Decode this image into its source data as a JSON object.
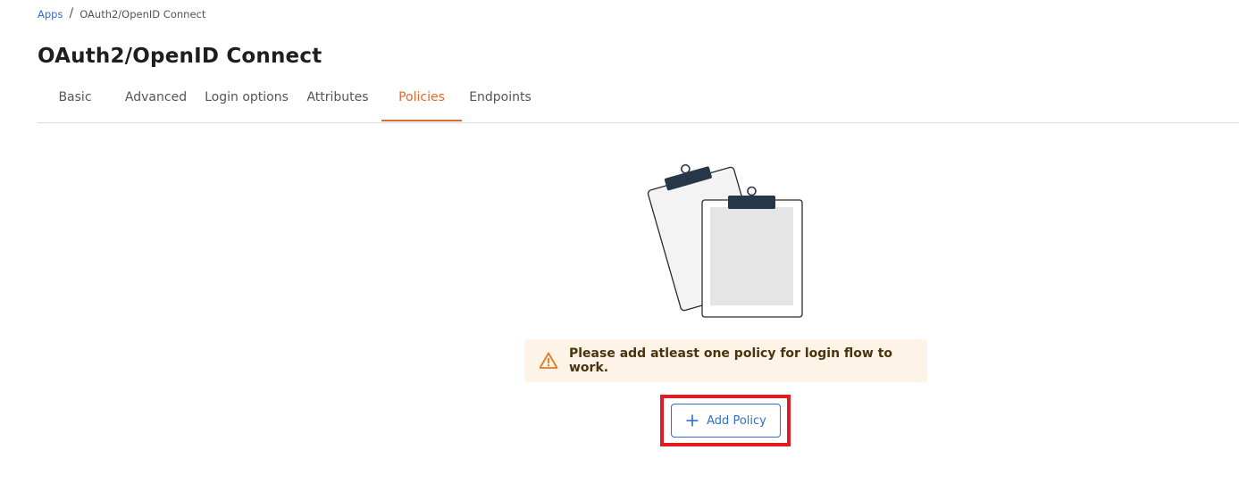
{
  "breadcrumb": {
    "root_label": "Apps",
    "separator": "/",
    "current_label": "OAuth2/OpenID Connect"
  },
  "page": {
    "title": "OAuth2/OpenID Connect"
  },
  "tabs": [
    {
      "label": "Basic",
      "active": false
    },
    {
      "label": "Advanced",
      "active": false
    },
    {
      "label": "Login options",
      "active": false
    },
    {
      "label": "Attributes",
      "active": false
    },
    {
      "label": "Policies",
      "active": true
    },
    {
      "label": "Endpoints",
      "active": false
    }
  ],
  "empty_state": {
    "illustration": "clipboards-icon",
    "warning_icon": "warning-triangle-icon",
    "warning_text": "Please add atleast one policy for login flow to work.",
    "add_button_icon": "plus-icon",
    "add_button_label": "Add Policy"
  },
  "colors": {
    "accent": "#e06a2c",
    "link": "#2f6fd1",
    "warning_bg": "#fdf3e7",
    "warning_icon": "#e07b1f",
    "highlight": "#e01b22"
  }
}
